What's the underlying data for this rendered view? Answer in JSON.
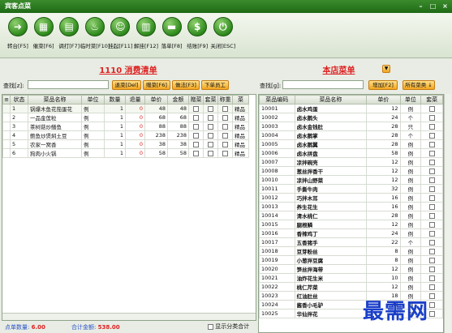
{
  "window": {
    "title": "宾客点菜"
  },
  "toolbar": [
    {
      "label": "转台[F5]",
      "icon": "arrow-icon",
      "glyph": "➜"
    },
    {
      "label": "催菜[F6]",
      "icon": "bank-icon",
      "glyph": "▦"
    },
    {
      "label": "调打[F7]",
      "icon": "printer-icon",
      "glyph": "▤"
    },
    {
      "label": "临时菜[F10]",
      "icon": "chef-icon",
      "glyph": "♨"
    },
    {
      "label": "挂起[F11]",
      "icon": "waiter-icon",
      "glyph": "☺"
    },
    {
      "label": "解挂[F12]",
      "icon": "document-icon",
      "glyph": "▥"
    },
    {
      "label": "落单[F8]",
      "icon": "folder-icon",
      "glyph": "▬"
    },
    {
      "label": "结账[F9]",
      "icon": "dollar-icon",
      "glyph": "$"
    },
    {
      "label": "关闭[ESC]",
      "icon": "power-icon",
      "glyph": "⏻"
    }
  ],
  "order": {
    "title_num": "1110",
    "title_text": "消费清单",
    "search_label": "查找[z]:",
    "search_value": "",
    "btn_return": "退菜[Del]",
    "btn_gift": "赠菜[F6]",
    "btn_method": "做法[F3]",
    "btn_staff": "下单员工",
    "columns": [
      "状态",
      "菜品名称",
      "单位",
      "数量",
      "退量",
      "单价",
      "金额",
      "赠菜",
      "套菜",
      "称重",
      "菜"
    ],
    "rows": [
      {
        "no": "1",
        "name": "锅爆木鱼花茄蛋花",
        "unit": "例",
        "qty": "1",
        "ret": "0",
        "price": "48",
        "amount": "48",
        "tail": "精品"
      },
      {
        "no": "2",
        "name": "一品金莲粒",
        "unit": "例",
        "qty": "1",
        "ret": "0",
        "price": "68",
        "amount": "68",
        "tail": "精品"
      },
      {
        "no": "3",
        "name": "茶树菇炒鳝鱼",
        "unit": "例",
        "qty": "1",
        "ret": "0",
        "price": "88",
        "amount": "88",
        "tail": "精品"
      },
      {
        "no": "4",
        "name": "鲍鱼炒煲焖土豆",
        "unit": "例",
        "qty": "1",
        "ret": "0",
        "price": "238",
        "amount": "238",
        "tail": "精品"
      },
      {
        "no": "5",
        "name": "农家一窝香",
        "unit": "例",
        "qty": "1",
        "ret": "0",
        "price": "38",
        "amount": "38",
        "tail": "精品"
      },
      {
        "no": "6",
        "name": "狗肉小火锅",
        "unit": "例",
        "qty": "1",
        "ret": "0",
        "price": "58",
        "amount": "58",
        "tail": "精品"
      }
    ],
    "count_label": "点单数量:",
    "count_value": "6.00",
    "total_label": "合计金额:",
    "total_value": "538.00",
    "show_category": "显示分类合计"
  },
  "menu": {
    "title": "本店菜单",
    "search_label": "查找[g]:",
    "search_value": "",
    "btn_add": "增加[F2]",
    "btn_all": "所有菜类 ↓",
    "columns": [
      "菜品编码",
      "菜品名称",
      "单价",
      "单位",
      "套菜"
    ],
    "rows": [
      {
        "code": "10001",
        "name": "卤水鸡蛋",
        "price": "12",
        "unit": "例"
      },
      {
        "code": "10002",
        "name": "卤水鹅头",
        "price": "24",
        "unit": "个"
      },
      {
        "code": "10003",
        "name": "卤水金钱肚",
        "price": "28",
        "unit": "只"
      },
      {
        "code": "10004",
        "name": "卤水鹅掌",
        "price": "28",
        "unit": "个"
      },
      {
        "code": "10005",
        "name": "卤水鹅翼",
        "price": "28",
        "unit": "例"
      },
      {
        "code": "10006",
        "name": "卤水拼盘",
        "price": "58",
        "unit": "例"
      },
      {
        "code": "10007",
        "name": "凉拌碗壳",
        "price": "12",
        "unit": "例"
      },
      {
        "code": "10008",
        "name": "葱丝拌香干",
        "price": "12",
        "unit": "例"
      },
      {
        "code": "10010",
        "name": "凉拌山野菜",
        "price": "12",
        "unit": "例"
      },
      {
        "code": "10011",
        "name": "手撕牛肉",
        "price": "32",
        "unit": "例"
      },
      {
        "code": "10012",
        "name": "巧拌木耳",
        "price": "16",
        "unit": "例"
      },
      {
        "code": "10013",
        "name": "养生花生",
        "price": "16",
        "unit": "例"
      },
      {
        "code": "10014",
        "name": "清水桃仁",
        "price": "28",
        "unit": "例"
      },
      {
        "code": "10015",
        "name": "腿根鳞",
        "price": "12",
        "unit": "例"
      },
      {
        "code": "10016",
        "name": "香辣鸡丁",
        "price": "24",
        "unit": "例"
      },
      {
        "code": "10017",
        "name": "五香猪手",
        "price": "22",
        "unit": "个"
      },
      {
        "code": "10018",
        "name": "豆芽粉丝",
        "price": "8",
        "unit": "例"
      },
      {
        "code": "10019",
        "name": "小葱拌豆腐",
        "price": "8",
        "unit": "例"
      },
      {
        "code": "10020",
        "name": "笋丝拌海带",
        "price": "12",
        "unit": "例"
      },
      {
        "code": "10021",
        "name": "油炸花生米",
        "price": "10",
        "unit": "例"
      },
      {
        "code": "10022",
        "name": "桃仁芹菜",
        "price": "12",
        "unit": "例"
      },
      {
        "code": "10023",
        "name": "红油肚丝",
        "price": "18",
        "unit": "例"
      },
      {
        "code": "10024",
        "name": "酱香小毛驴",
        "price": "28",
        "unit": "例"
      },
      {
        "code": "10025",
        "name": "华仙拌花",
        "price": "28",
        "unit": "例"
      }
    ]
  },
  "watermark": "最需网",
  "colors": {
    "accent": "#dd2222",
    "brand_green": "#2f8a1d",
    "button_orange": "#f0a520"
  }
}
